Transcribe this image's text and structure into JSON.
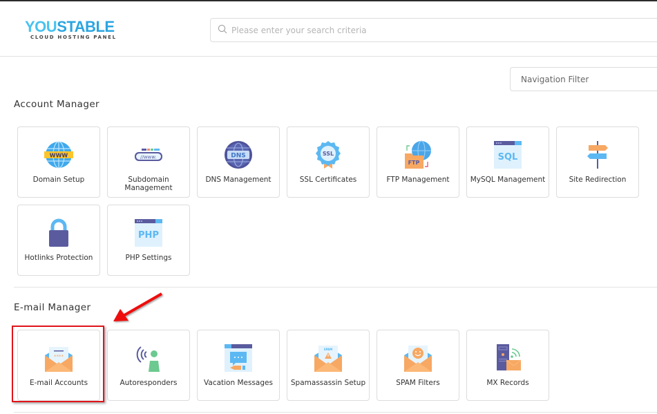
{
  "header": {
    "logo": {
      "brand_you": "YOU",
      "brand_stable": "STABLE",
      "tagline": "CLOUD HOSTING PANEL"
    },
    "search": {
      "placeholder": "Please enter your search criteria",
      "value": "",
      "icon": "search-icon"
    }
  },
  "nav_filter": {
    "placeholder": "Navigation Filter",
    "value": ""
  },
  "sections": [
    {
      "title": "Account Manager",
      "items": [
        {
          "label": "Domain Setup",
          "icon": "www-globe-icon"
        },
        {
          "label": "Subdomain Management",
          "icon": "subdomain-icon"
        },
        {
          "label": "DNS Management",
          "icon": "dns-globe-icon"
        },
        {
          "label": "SSL Certificates",
          "icon": "ssl-badge-icon"
        },
        {
          "label": "FTP Management",
          "icon": "ftp-folder-icon"
        },
        {
          "label": "MySQL Management",
          "icon": "sql-window-icon"
        },
        {
          "label": "Site Redirection",
          "icon": "signpost-icon"
        },
        {
          "label": "Hotlinks Protection",
          "icon": "padlock-icon"
        },
        {
          "label": "PHP Settings",
          "icon": "php-window-icon"
        }
      ]
    },
    {
      "title": "E-mail Manager",
      "items": [
        {
          "label": "E-mail Accounts",
          "icon": "email-envelope-icon",
          "highlighted": true
        },
        {
          "label": "Autoresponders",
          "icon": "autoresponder-person-icon"
        },
        {
          "label": "Vacation Messages",
          "icon": "vacation-message-icon"
        },
        {
          "label": "Spamassassin Setup",
          "icon": "spam-envelope-icon"
        },
        {
          "label": "SPAM Filters",
          "icon": "smiley-envelope-icon"
        },
        {
          "label": "MX Records",
          "icon": "mx-server-icon"
        }
      ]
    }
  ],
  "annotation": {
    "color": "#e0141b",
    "target": "E-mail Accounts"
  },
  "colors": {
    "accent_blue": "#3bb6ea",
    "icon_orange": "#f7a863",
    "icon_purple": "#5a5b9f",
    "icon_lightblue": "#5cb8f2",
    "icon_green": "#6cc990"
  }
}
